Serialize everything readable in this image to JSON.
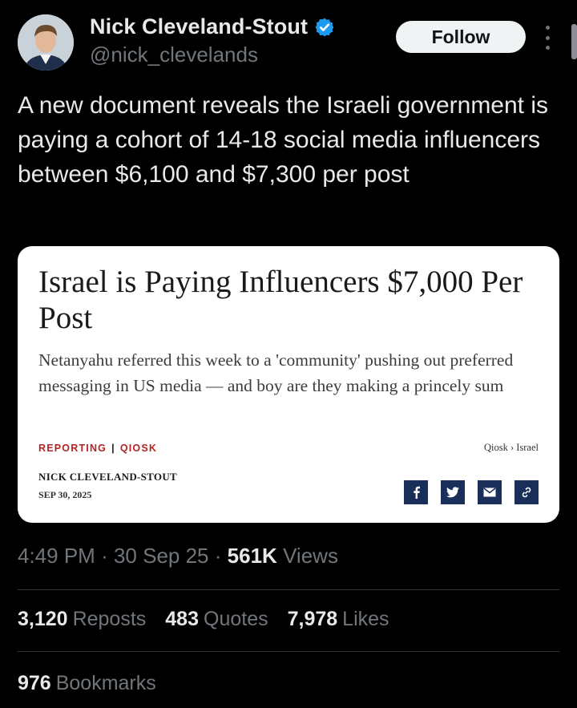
{
  "author": {
    "name": "Nick Cleveland-Stout",
    "handle": "@nick_clevelands",
    "follow_label": "Follow"
  },
  "tweet": {
    "text": "A new document reveals the Israeli government is paying a cohort of 14-18 social media influencers between $6,100 and $7,300 per post"
  },
  "card": {
    "title": "Israel is Paying Influencers $7,000 Per Post",
    "subtitle": "Netanyahu referred this week to a 'community' pushing out preferred messaging in US media — and boy are they making a princely sum",
    "tag_1": "REPORTING",
    "tag_sep": "|",
    "tag_2": "QIOSK",
    "breadcrumb": "Qiosk › Israel",
    "byline": "NICK CLEVELAND-STOUT",
    "date": "SEP 30, 2025",
    "share_icons": [
      "facebook-icon",
      "twitter-icon",
      "email-icon",
      "link-icon"
    ]
  },
  "meta": {
    "time": "4:49 PM",
    "date": "30 Sep 25",
    "views_count": "561K",
    "views_label": "Views"
  },
  "stats": {
    "reposts_count": "3,120",
    "reposts_label": "Reposts",
    "quotes_count": "483",
    "quotes_label": "Quotes",
    "likes_count": "7,978",
    "likes_label": "Likes",
    "bookmarks_count": "976",
    "bookmarks_label": "Bookmarks"
  },
  "colors": {
    "background": "#000000",
    "text_primary": "#e7e9ea",
    "text_secondary": "#71767b",
    "verified": "#1d9bf0",
    "card_tag_red": "#b42424",
    "share_navy": "#1a2e5a"
  }
}
